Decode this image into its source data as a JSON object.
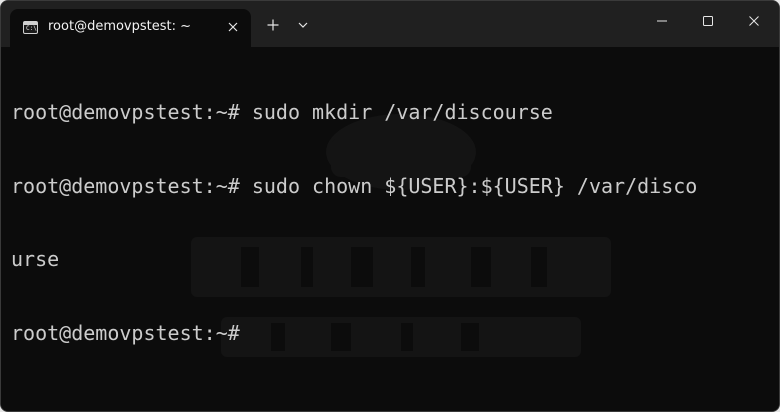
{
  "window": {
    "tab": {
      "icon": "terminal-icon",
      "icon_text": "C:\\",
      "title": "root@demovpstest: ~"
    },
    "new_tab_icon": "plus-icon",
    "dropdown_icon": "chevron-down-icon",
    "controls": {
      "minimize_icon": "minimize-icon",
      "maximize_icon": "maximize-icon",
      "close_icon": "close-icon"
    }
  },
  "terminal": {
    "lines": [
      "root@demovpstest:~# sudo mkdir /var/discourse",
      "root@demovpstest:~# sudo chown ${USER}:${USER} /var/disco",
      "urse",
      "root@demovpstest:~# "
    ],
    "foreground": "#cccccc",
    "background": "#0c0c0c"
  }
}
